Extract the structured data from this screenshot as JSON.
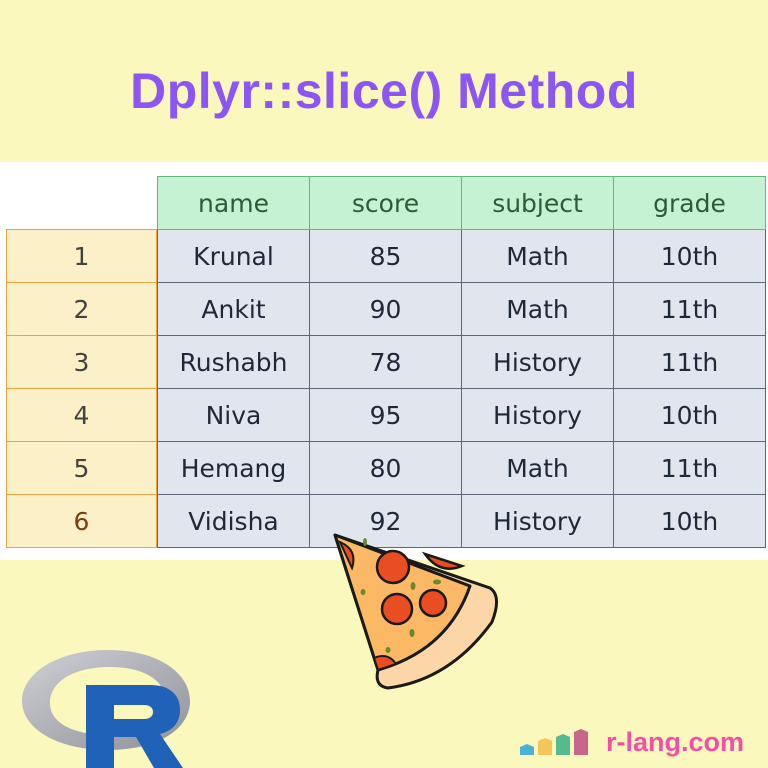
{
  "title": "Dplyr::slice() Method",
  "table": {
    "columns": [
      "name",
      "score",
      "subject",
      "grade"
    ],
    "rows": [
      [
        "Krunal",
        "85",
        "Math",
        "10th"
      ],
      [
        "Ankit",
        "90",
        "Math",
        "11th"
      ],
      [
        "Rushabh",
        "78",
        "History",
        "11th"
      ],
      [
        "Niva",
        "95",
        "History",
        "10th"
      ],
      [
        "Hemang",
        "80",
        "Math",
        "11th"
      ],
      [
        "Vidisha",
        "92",
        "History",
        "10th"
      ]
    ],
    "row_index": [
      "1",
      "2",
      "3",
      "4",
      "5",
      "6"
    ]
  },
  "decorations": {
    "pizza": "pizza-slice-icon",
    "logo": "r-logo-icon"
  },
  "brand": {
    "text": "r-lang.com",
    "bar_colors": [
      "#4bb3d6",
      "#f3c55b",
      "#53bb8f",
      "#c7688b"
    ]
  },
  "colors": {
    "title": "#8e55f5",
    "header_bg": "#c5f2d2",
    "cell_bg": "#e1e5ee",
    "index_bg": "#fcf0c8",
    "index_border": "#e9a43f",
    "brand_text": "#f24fa6",
    "r_blue": "#1f62b7"
  }
}
